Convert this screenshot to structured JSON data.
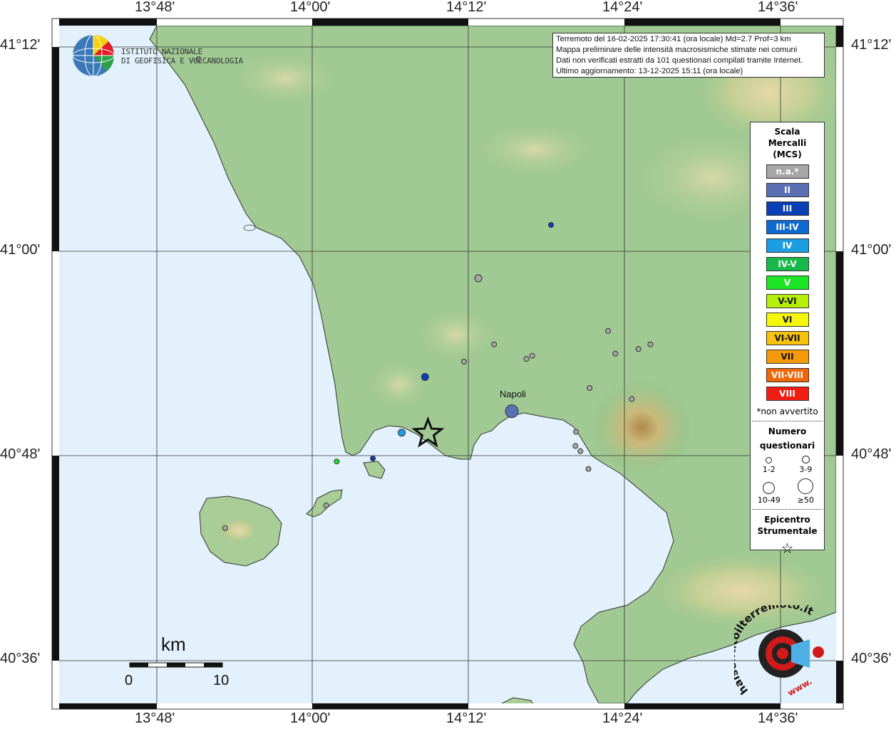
{
  "header": {
    "line1": "Terremoto del 16-02-2025 17:30:41 (ora locale) Md=2.7 Prof=3 km",
    "line2": "Mappa preliminare delle intensità macrosismiche stimate nei comuni",
    "line3": "Dati non verificati estratti da 101 questionari compilati tramite Internet.",
    "line4": "Ultimo aggiornamento: 13-12-2025 15:11 (ora locale)"
  },
  "logo": {
    "line1": "ISTITUTO NAZIONALE",
    "line2": "DI GEOFISICA E VULCANOLOGIA"
  },
  "axes": {
    "top": [
      "13°48'",
      "14°00'",
      "14°12'",
      "14°24'",
      "14°36'"
    ],
    "bottom": [
      "13°48'",
      "14°00'",
      "14°12'",
      "14°24'",
      "14°36'"
    ],
    "left": [
      "41°12'",
      "41°00'",
      "40°48'",
      "40°36'"
    ],
    "right": [
      "41°12'",
      "41°00'",
      "40°48'",
      "40°36'"
    ]
  },
  "legend": {
    "title1": "Scala",
    "title2": "Mercalli",
    "title3": "(MCS)",
    "classes": [
      {
        "label": "n.a.*",
        "color": "#a6a6a6"
      },
      {
        "label": "II",
        "color": "#5b6fb5"
      },
      {
        "label": "III",
        "color": "#0a3fb5"
      },
      {
        "label": "III-IV",
        "color": "#0f6ad0"
      },
      {
        "label": "IV",
        "color": "#1c9ee3"
      },
      {
        "label": "IV-V",
        "color": "#18b84a"
      },
      {
        "label": "V",
        "color": "#1ee626"
      },
      {
        "label": "V-VI",
        "color": "#b6f00a"
      },
      {
        "label": "VI",
        "color": "#f4f70a"
      },
      {
        "label": "VI-VII",
        "color": "#f7c20a"
      },
      {
        "label": "VII",
        "color": "#f49a0a"
      },
      {
        "label": "VII-VIII",
        "color": "#f0670a"
      },
      {
        "label": "VIII",
        "color": "#f01e12"
      }
    ],
    "not_felt_note": "*non avvertito",
    "questionnaires_title1": "Numero",
    "questionnaires_title2": "questionari",
    "sizes": [
      "1-2",
      "3-9",
      "10-49",
      "≥50"
    ],
    "epicenter_title1": "Epicentro",
    "epicenter_title2": "Strumentale"
  },
  "scale_bar": {
    "unit": "km",
    "min": "0",
    "max": "10"
  },
  "places": {
    "napoli": "Napoli"
  },
  "watermark": {
    "site": "haisentitoilterremoto.it",
    "url_fragment": "www."
  },
  "observations": [
    {
      "lon": 13.8545,
      "lat": 41.188,
      "intensity": "n.a.*",
      "size": "1-2"
    },
    {
      "lon": 14.3059,
      "lat": 41.0258,
      "intensity": "III",
      "size": "1-2"
    },
    {
      "lon": 14.2128,
      "lat": 40.9736,
      "intensity": "n.a.*",
      "size": "3-9"
    },
    {
      "lon": 14.3791,
      "lat": 40.922,
      "intensity": "n.a.*",
      "size": "1-2"
    },
    {
      "lon": 14.233,
      "lat": 40.9089,
      "intensity": "n.a.*",
      "size": "1-2"
    },
    {
      "lon": 14.418,
      "lat": 40.9043,
      "intensity": "n.a.*",
      "size": "1-2"
    },
    {
      "lon": 14.4332,
      "lat": 40.9089,
      "intensity": "n.a.*",
      "size": "1-2"
    },
    {
      "lon": 14.3884,
      "lat": 40.8998,
      "intensity": "n.a.*",
      "size": "1-2"
    },
    {
      "lon": 14.2744,
      "lat": 40.8946,
      "intensity": "n.a.*",
      "size": "1-2"
    },
    {
      "lon": 14.2818,
      "lat": 40.8977,
      "intensity": "n.a.*",
      "size": "1-2"
    },
    {
      "lon": 14.1944,
      "lat": 40.892,
      "intensity": "n.a.*",
      "size": "1-2"
    },
    {
      "lon": 14.1446,
      "lat": 40.877,
      "intensity": "III",
      "size": "3-9"
    },
    {
      "lon": 14.4094,
      "lat": 40.8555,
      "intensity": "n.a.*",
      "size": "1-2"
    },
    {
      "lon": 14.3553,
      "lat": 40.8662,
      "intensity": "n.a.*",
      "size": "1-2"
    },
    {
      "lon": 14.2557,
      "lat": 40.8435,
      "intensity": "II",
      "size": "10-49"
    },
    {
      "lon": 14.1146,
      "lat": 40.8225,
      "intensity": "IV",
      "size": "3-9"
    },
    {
      "lon": 14.3379,
      "lat": 40.8233,
      "intensity": "n.a.*",
      "size": "1-2"
    },
    {
      "lon": 14.3373,
      "lat": 40.8095,
      "intensity": "n.a.*",
      "size": "1-2"
    },
    {
      "lon": 14.3436,
      "lat": 40.8043,
      "intensity": "n.a.*",
      "size": "1-2"
    },
    {
      "lon": 14.0777,
      "lat": 40.7972,
      "intensity": "III",
      "size": "1-2"
    },
    {
      "lon": 14.0314,
      "lat": 40.7943,
      "intensity": "V",
      "size": "1-2"
    },
    {
      "lon": 14.3539,
      "lat": 40.787,
      "intensity": "n.a.*",
      "size": "1-2"
    },
    {
      "lon": 14.0178,
      "lat": 40.7512,
      "intensity": "n.a.*",
      "size": "1-2"
    },
    {
      "lon": 13.8885,
      "lat": 40.729,
      "intensity": "n.a.*",
      "size": "1-2"
    }
  ],
  "epicenter": {
    "lon": 14.1483,
    "lat": 40.8216
  }
}
